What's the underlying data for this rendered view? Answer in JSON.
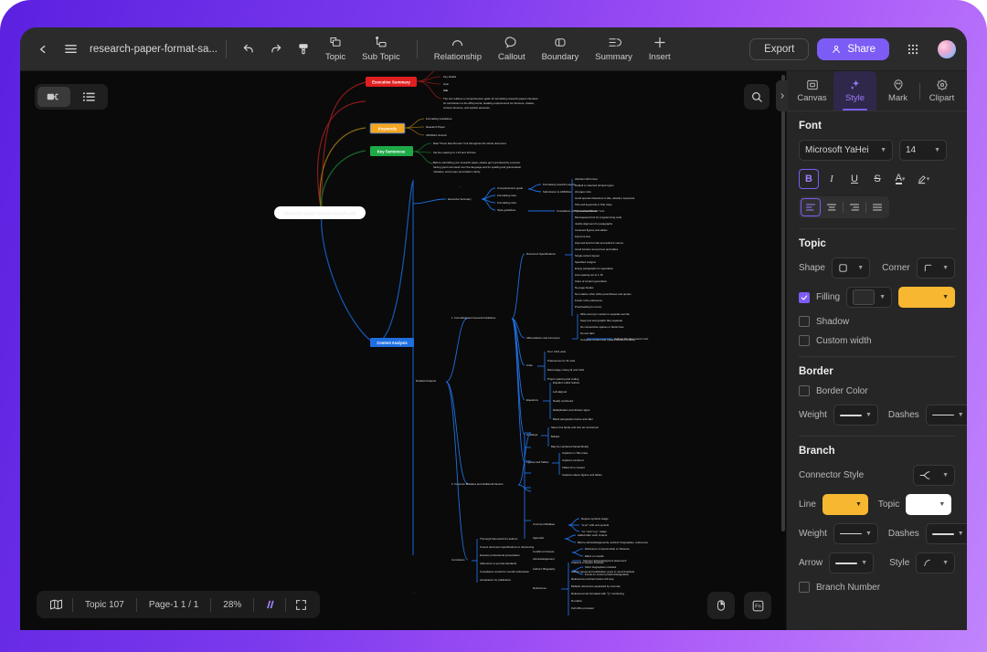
{
  "topbar": {
    "back_icon": "chevron-left-icon",
    "menu_icon": "hamburger-menu-icon",
    "doc_title": "research-paper-format-sa...",
    "undo_icon": "undo-icon",
    "redo_icon": "redo-icon",
    "clipboard_icon": "format-painter-icon",
    "tools": [
      {
        "icon": "topic-icon",
        "label": "Topic"
      },
      {
        "icon": "sub-topic-icon",
        "label": "Sub Topic"
      },
      {
        "icon": "relationship-icon",
        "label": "Relationship"
      },
      {
        "icon": "callout-icon",
        "label": "Callout"
      },
      {
        "icon": "boundary-icon",
        "label": "Boundary"
      },
      {
        "icon": "summary-icon",
        "label": "Summary"
      },
      {
        "icon": "insert-plus-icon",
        "label": "Insert"
      }
    ],
    "export_label": "Export",
    "share_label": "Share",
    "share_icon": "person-share-icon",
    "apps_icon": "grid-apps-icon",
    "avatar": "user-avatar"
  },
  "canvas": {
    "view_toggle": {
      "map_view_icon": "mindmap-view-icon",
      "outline_view_icon": "outline-view-icon"
    },
    "search_icon": "search-icon",
    "root_topic": "research-paper-format-sample.pdf",
    "branches": [
      {
        "label": "Executive Summary",
        "color": "#e02020",
        "text": "#ffffff"
      },
      {
        "label": "Keywords",
        "color": "#f5a623",
        "text": "#ffffff"
      },
      {
        "label": "Key Sentences",
        "color": "#1faa48",
        "text": "#ffffff"
      },
      {
        "label": "Content Analysis",
        "color": "#1f6fe0",
        "text": "#ffffff"
      }
    ],
    "summary_lines": [
      "Key details",
      "style",
      "title",
      "The text outlines a comprehensive guide for formatting research papers intended",
      "for submission to the APA journal, detailing requirements for structure, citation,",
      "content structure, and stylistic elements."
    ],
    "keyword_children": [
      "Formatting Guidelines",
      "Research Paper",
      "APA/MLA Journal"
    ],
    "key_sentence_children": [
      "Use \"Times New Roman\" font throughout the whole document.",
      "Set line spacing to 1.15 and 10 lines.",
      "Before submitting your research paper, please get it proofread by a person",
      "having good command over the language and for spelling and grammatical",
      "mistakes, and proper punctuation clarity."
    ],
    "exec_children": [
      {
        "label": "Comprehensive guide",
        "children": [
          "Formatting research papers",
          "Submission to APA/MLA"
        ]
      },
      {
        "label": "Formatting structure"
      },
      {
        "label": "Formatting rules"
      },
      {
        "label": "Style guidelines",
        "children": [
          "Compliance with journal standards"
        ]
      }
    ],
    "detailed_analysis_label": "Detailed Analysis",
    "detailed_sections": [
      {
        "label": "1. Formatting and General Guidelines",
        "groups": [
          {
            "label": "Document Specifications",
            "items": [
              "A4 or Letter format",
              "Default or selected printed region",
              "A4 paper size",
              "Avoid special characters in title, abstract, keywords",
              "Title and keywords in Title Case",
              "\"Times New Roman\" font",
              "Monospaced font for programming code",
              "Justify alignment for paragraphs",
              "Centered figures and tables",
              "10pt font size",
              "10pt and bold for title and authors' names",
              "Avoid borders around text and tables",
              "Single-column layout",
              "Specified margins",
              "Empty paragraphs for separation",
              "Line spacing set to 1.15",
              "Index of content generation",
              "No page breaks",
              "No notation other white parentheses and quotes",
              "Footer color preference",
              "Proofreading for errors"
            ]
          },
          {
            "label": "Abbreviations and Acronyms",
            "items": [
              "Write acronym content in separate text file",
              "Keep text and graphic files separate",
              "No consecutive spaces or blank lines",
              "No text tabs",
              "Complete content and unparenthesized editing",
              "Defined first time used in text"
            ]
          },
          {
            "label": "Units",
            "items": [
              "SI or CGS units",
              "Preferences for SI units",
              "Discourage mixing SI and CGS",
              "Proper spacing and coding"
            ]
          },
          {
            "label": "Equations",
            "items": [
              "Equation editor feature",
              "Left-aligned",
              "Neatly numbered",
              "Multiplication and division signs",
              "Blank paragraphs before and after"
            ]
          },
          {
            "label": "Headings",
            "items": [
              "Same font family and size as normal text",
              "Bolded",
              "May be numbered hierarchically"
            ]
          },
          {
            "label": "Figures and Tables",
            "items": [
              "Captions in Title Case",
              "Captions centered",
              "Tables fit to content",
              "Captions above figures and tables"
            ]
          }
        ]
      },
      {
        "label": "2. Common Mistakes and Additional Factors",
        "groups": [
          {
            "label": "Common Mistakes",
            "items": [
              "Degree symbols usage",
              "\"et al.\" with end periods",
              "\"vs.\" and \"e.g.\" usage"
            ]
          },
          {
            "label": "Appendix",
            "items": [
              "Added after main content",
              "Before acknowledgements, authors' biographies, references"
            ]
          },
          {
            "label": "Conflict of Interest",
            "items": [
              "Disclosure of sponsorship or influence",
              "Effect on results"
            ]
          },
          {
            "label": "Acknowledgement",
            "items": [
              "Sponsor acknowledgment placement"
            ]
          },
          {
            "label": "Authors' Biography",
            "items": [
              "Short biographies included",
              "Focus on current position/designation"
            ]
          },
          {
            "label": "References",
            "items": [
              "Citations in square brackets",
              "Author names and publication years in round brackets",
              "References numbers before full stop",
              "Multiple references separated by commas",
              "References list formatted with \"[ ]\" numbering",
              "No italics",
              "Full URLs provided"
            ]
          }
        ]
      },
      {
        "label": "Conclusion",
        "items": [
          "Thorough framework for authors",
          "Covers document specifications to referencing",
          "Ensures professional presentation",
          "Adherence to journal standards",
          "Compliance crucial for smooth submission",
          "Acceptance for publication"
        ]
      }
    ]
  },
  "statusbar": {
    "map_icon": "map-overview-icon",
    "topic_count": "Topic 107",
    "page": "Page-1  1 / 1",
    "zoom": "28%",
    "brand_icon": "brand-logo-icon",
    "fullscreen_icon": "fullscreen-icon",
    "mouse_icon": "mouse-mode-icon",
    "fn_icon": "fn-key-icon"
  },
  "panel": {
    "collapse_icon": "chevron-right-icon",
    "tabs": [
      {
        "label": "Canvas",
        "icon": "canvas-icon",
        "active": false
      },
      {
        "label": "Style",
        "icon": "style-sparkle-icon",
        "active": true
      },
      {
        "label": "Mark",
        "icon": "mark-icon",
        "active": false
      },
      {
        "label": "Clipart",
        "icon": "clipart-icon",
        "active": false
      }
    ],
    "font": {
      "heading": "Font",
      "family": "Microsoft YaHei",
      "size": "14",
      "bold_label": "B",
      "italic_label": "I",
      "underline_label": "U",
      "strike_label": "S",
      "color_label": "A",
      "highlight_label": "highlight-pen-icon",
      "align_icons": [
        "align-left-icon",
        "align-center-icon",
        "align-right-icon",
        "align-justify-icon"
      ]
    },
    "topic": {
      "heading": "Topic",
      "shape_label": "Shape",
      "corner_label": "Corner",
      "filling_label": "Filling",
      "filling_checked": true,
      "fill_swatch": "#2b2b2b",
      "fill_color": "#f7b731",
      "shadow_label": "Shadow",
      "shadow_checked": false,
      "custom_width_label": "Custom width",
      "custom_width_checked": false
    },
    "border": {
      "heading": "Border",
      "border_color_label": "Border Color",
      "border_color_checked": false,
      "weight_label": "Weight",
      "dashes_label": "Dashes"
    },
    "branch": {
      "heading": "Branch",
      "connector_label": "Connector Style",
      "line_label": "Line",
      "line_color": "#f7b731",
      "topic_label": "Topic",
      "topic_color": "#ffffff",
      "weight_label": "Weight",
      "dashes_label": "Dashes",
      "arrow_label": "Arrow",
      "style_label": "Style",
      "branch_number_label": "Branch Number",
      "branch_number_checked": false
    }
  }
}
